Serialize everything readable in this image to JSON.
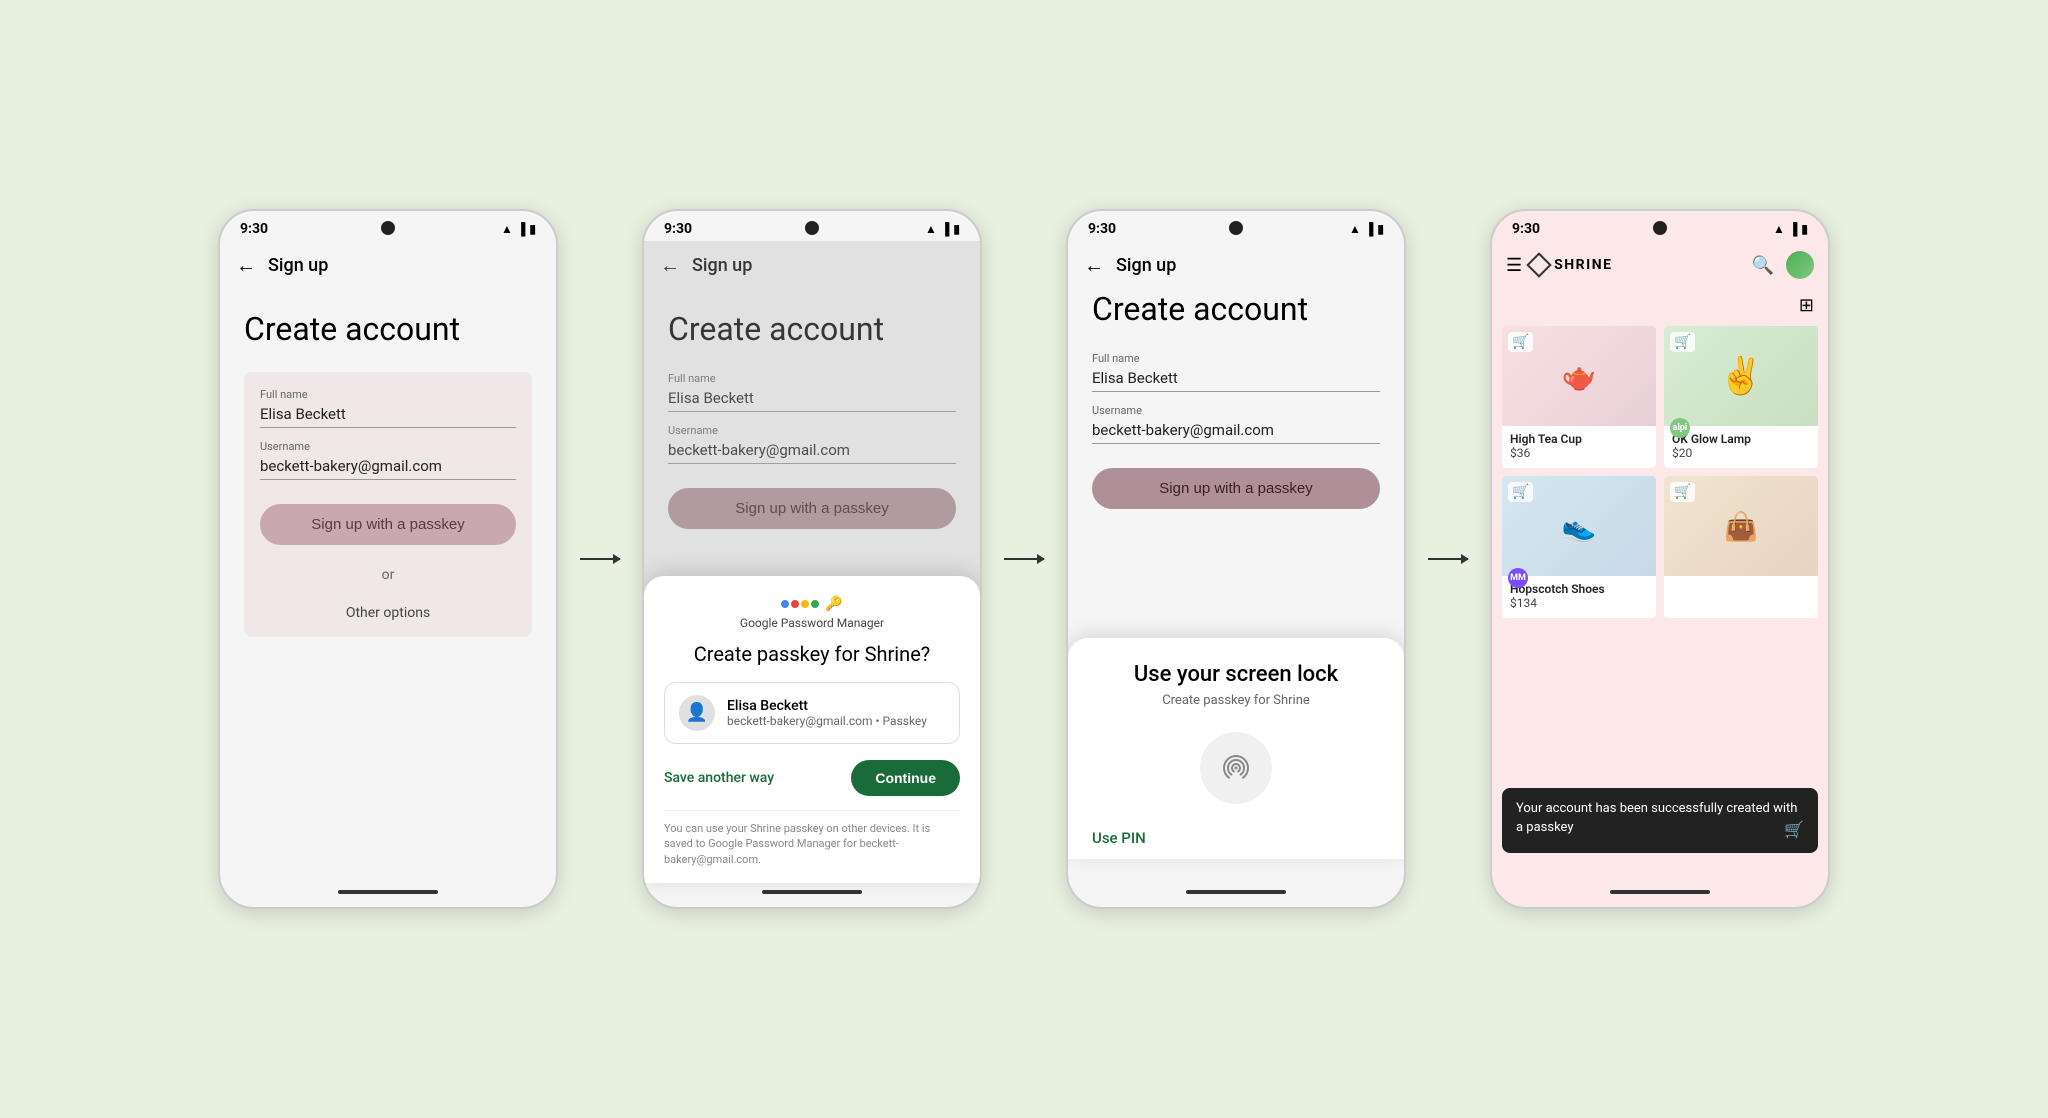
{
  "screens": [
    {
      "id": "screen1",
      "status_time": "9:30",
      "app_bar_title": "Sign up",
      "heading": "Create account",
      "full_name_label": "Full name",
      "full_name_value": "Elisa Beckett",
      "username_label": "Username",
      "username_value": "beckett-bakery@gmail.com",
      "passkey_btn_label": "Sign up with a passkey",
      "or_text": "or",
      "other_options": "Other options"
    },
    {
      "id": "screen2",
      "status_time": "9:30",
      "app_bar_title": "Sign up",
      "heading": "Create account",
      "full_name_label": "Full name",
      "full_name_value": "Elisa Beckett",
      "username_label": "Username",
      "username_value": "beckett-bakery@gmail.com",
      "passkey_btn_label": "Sign up with a passkey",
      "sheet": {
        "pm_label": "Google Password Manager",
        "title": "Create passkey for Shrine?",
        "user_name": "Elisa Beckett",
        "user_sub": "beckett-bakery@gmail.com • Passkey",
        "save_another_way": "Save another way",
        "continue_btn": "Continue",
        "footer_text": "You can use your Shrine passkey on other devices. It is saved to Google Password Manager for beckett-bakery@gmail.com."
      }
    },
    {
      "id": "screen3",
      "status_time": "9:30",
      "app_bar_title": "Sign up",
      "heading": "Create account",
      "full_name_label": "Full name",
      "full_name_value": "Elisa Beckett",
      "username_label": "Username",
      "username_value": "beckett-bakery@gmail.com",
      "passkey_btn_label": "Sign up with a passkey",
      "screen_lock": {
        "title": "Use your screen lock",
        "subtitle": "Create passkey for Shrine",
        "use_pin": "Use PIN"
      }
    },
    {
      "id": "screen4",
      "status_time": "9:30",
      "app_name": "SHRINE",
      "products": [
        {
          "name": "High Tea Cup",
          "price": "$36",
          "emoji": "🫖",
          "bg": "tea"
        },
        {
          "name": "OK Glow Lamp",
          "price": "$20",
          "emoji": "✌️",
          "bg": "plant"
        },
        {
          "name": "Hopscotch Shoes",
          "price": "$134",
          "emoji": "👟",
          "bg": "shoes"
        },
        {
          "name": "",
          "price": "",
          "emoji": "👜",
          "bg": "handbag"
        }
      ],
      "toast": "Your account has been successfully created with a passkey"
    }
  ],
  "arrows": [
    "→",
    "→"
  ]
}
